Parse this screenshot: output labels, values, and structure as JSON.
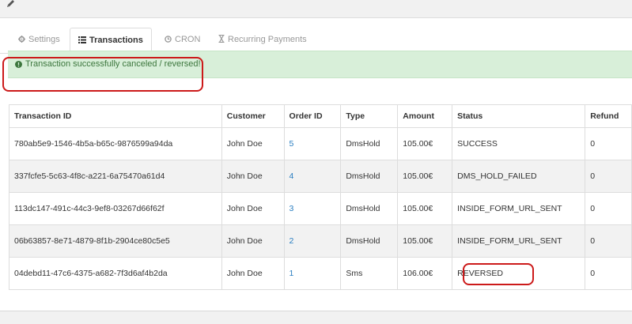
{
  "tabs": [
    {
      "label": "Settings",
      "icon": "gear-icon"
    },
    {
      "label": "Transactions",
      "icon": "list-icon"
    },
    {
      "label": "CRON",
      "icon": "clock-icon"
    },
    {
      "label": "Recurring Payments",
      "icon": "hourglass-icon"
    }
  ],
  "active_tab": "Transactions",
  "alert": {
    "message": "Transaction successfully canceled / reversed!",
    "icon": "exclamation-circle-icon",
    "color": "#3c763d"
  },
  "table": {
    "headers": [
      "Transaction ID",
      "Customer",
      "Order ID",
      "Type",
      "Amount",
      "Status",
      "Refund"
    ],
    "rows": [
      {
        "transaction_id": "780ab5e9-1546-4b5a-b65c-9876599a94da",
        "customer": "John Doe",
        "order_id": "5",
        "type": "DmsHold",
        "amount": "105.00€",
        "status": "SUCCESS",
        "refund": "0"
      },
      {
        "transaction_id": "337fcfe5-5c63-4f8c-a221-6a75470a61d4",
        "customer": "John Doe",
        "order_id": "4",
        "type": "DmsHold",
        "amount": "105.00€",
        "status": "DMS_HOLD_FAILED",
        "refund": "0"
      },
      {
        "transaction_id": "113dc147-491c-44c3-9ef8-03267d66f62f",
        "customer": "John Doe",
        "order_id": "3",
        "type": "DmsHold",
        "amount": "105.00€",
        "status": "INSIDE_FORM_URL_SENT",
        "refund": "0"
      },
      {
        "transaction_id": "06b63857-8e71-4879-8f1b-2904ce80c5e5",
        "customer": "John Doe",
        "order_id": "2",
        "type": "DmsHold",
        "amount": "105.00€",
        "status": "INSIDE_FORM_URL_SENT",
        "refund": "0"
      },
      {
        "transaction_id": "04debd11-47c6-4375-a682-7f3d6af4b2da",
        "customer": "John Doe",
        "order_id": "1",
        "type": "Sms",
        "amount": "106.00€",
        "status": "REVERSED",
        "refund": "0"
      }
    ]
  },
  "highlight_color": "#cc1a1a"
}
